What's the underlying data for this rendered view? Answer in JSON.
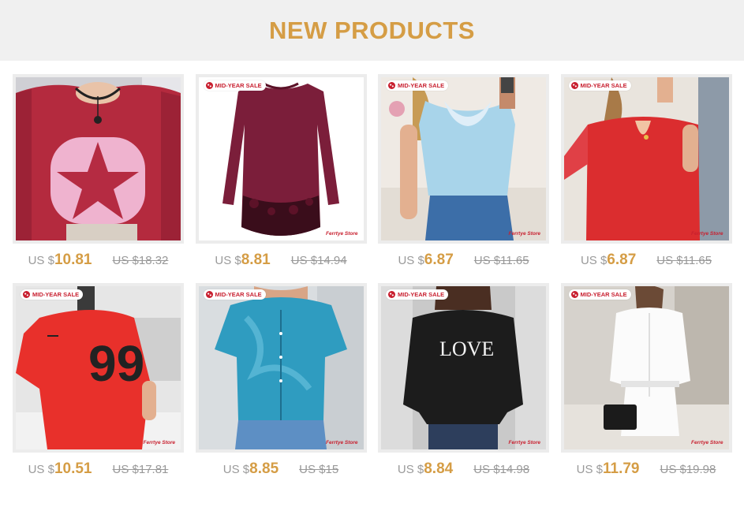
{
  "header": {
    "title": "NEW PRODUCTS"
  },
  "colors": {
    "accent": "#d59d45",
    "sale_red": "#c81f2f",
    "header_bg": "#f0f0f0"
  },
  "products": [
    {
      "sale_tag": "",
      "store": "",
      "currency": "US $",
      "price": "10.81",
      "old_price": "US $18.32",
      "image": "red star sweater"
    },
    {
      "sale_tag": "MID-YEAR SALE",
      "store": "Ferrtye Store",
      "currency": "US $",
      "price": "8.81",
      "old_price": "US $14.94",
      "image": "burgundy lace tunic"
    },
    {
      "sale_tag": "MID-YEAR SALE",
      "store": "Ferrtye Store",
      "currency": "US $",
      "price": "6.87",
      "old_price": "US $11.65",
      "image": "blue lace top"
    },
    {
      "sale_tag": "MID-YEAR SALE",
      "store": "Ferrtye Store",
      "currency": "US $",
      "price": "6.87",
      "old_price": "US $11.65",
      "image": "red keyhole blouse"
    },
    {
      "sale_tag": "MID-YEAR SALE",
      "store": "Ferrtye Store",
      "currency": "US $",
      "price": "10.51",
      "old_price": "US $17.81",
      "image": "red 99 jersey dress"
    },
    {
      "sale_tag": "MID-YEAR SALE",
      "store": "Ferrtye Store",
      "currency": "US $",
      "price": "8.85",
      "old_price": "US $15",
      "image": "blue tie-dye crop tee"
    },
    {
      "sale_tag": "MID-YEAR SALE",
      "store": "Ferrtye Store",
      "currency": "US $",
      "price": "8.84",
      "old_price": "US $14.98",
      "image": "black LOVE sweatshirt"
    },
    {
      "sale_tag": "MID-YEAR SALE",
      "store": "Ferrtye Store",
      "currency": "US $",
      "price": "11.79",
      "old_price": "US $19.98",
      "image": "white shirt dress"
    }
  ]
}
